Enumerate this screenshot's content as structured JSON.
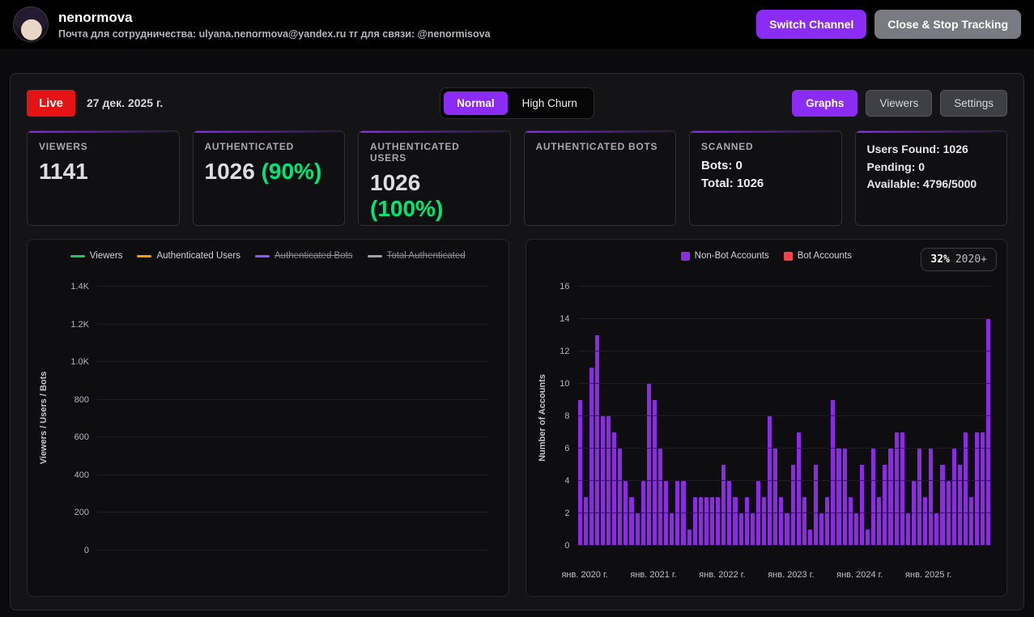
{
  "header": {
    "channel_name": "nenormova",
    "subtitle": "Почта для сотрудничества: ulyana.nenormova@yandex.ru тг для связи: @nenormisova",
    "buttons": {
      "switch_channel": "Switch Channel",
      "close_stop": "Close & Stop Tracking"
    }
  },
  "toolbar": {
    "live": "Live",
    "date": "27 дек. 2025 г.",
    "modes": {
      "normal": "Normal",
      "high_churn": "High Churn"
    },
    "views": {
      "graphs": "Graphs",
      "viewers": "Viewers",
      "settings": "Settings"
    }
  },
  "stats": {
    "viewers": {
      "title": "VIEWERS",
      "value": "1141"
    },
    "authenticated": {
      "title": "AUTHENTICATED",
      "value": "1026",
      "percent": "(90%)"
    },
    "authenticated_users": {
      "title": "AUTHENTICATED USERS",
      "value": "1026",
      "percent": "(100%)"
    },
    "authenticated_bots": {
      "title": "AUTHENTICATED BOTS"
    },
    "scanned": {
      "title": "SCANNED",
      "bots": "Bots: 0",
      "total": "Total: 1026"
    },
    "capacity": {
      "users_found": "Users Found: 1026",
      "pending": "Pending: 0",
      "available": "Available: 4796/5000"
    }
  },
  "colors": {
    "accent_purple": "#8b2cf5",
    "live_red": "#e51313",
    "green": "#00e676",
    "bar_purple": "#8b2be2",
    "bot_red": "#ef4444"
  },
  "chart_data": [
    {
      "type": "line",
      "ylabel": "Viewers / Users / Bots",
      "ylim": [
        0,
        1400
      ],
      "yticks": [
        "0",
        "200",
        "400",
        "600",
        "800",
        "1.0K",
        "1.2K",
        "1.4K"
      ],
      "legend": [
        {
          "label": "Viewers",
          "color": "#22c55e",
          "disabled": false
        },
        {
          "label": "Authenticated Users",
          "color": "#f59e0b",
          "disabled": false
        },
        {
          "label": "Authenticated Bots",
          "color": "#8b5cf6",
          "disabled": true
        },
        {
          "label": "Total Authenticated",
          "color": "#9ca3af",
          "disabled": true
        }
      ],
      "series": [],
      "note": "no data plotted yet"
    },
    {
      "type": "bar",
      "ylabel": "Number of Accounts",
      "ylim": [
        0,
        16
      ],
      "yticks": [
        "0",
        "2",
        "4",
        "6",
        "8",
        "10",
        "12",
        "14",
        "16"
      ],
      "badge": {
        "percent": "32%",
        "suffix": "2020+"
      },
      "legend": [
        {
          "label": "Non-Bot Accounts",
          "color": "#8b2be2"
        },
        {
          "label": "Bot Accounts",
          "color": "#ef4444"
        }
      ],
      "x_tick_labels": [
        "янв. 2020 г.",
        "янв. 2021 г.",
        "янв. 2022 г.",
        "янв. 2023 г.",
        "янв. 2024 г.",
        "янв. 2025 г."
      ],
      "x_tick_positions": [
        0,
        12,
        24,
        36,
        48,
        60
      ],
      "months_total": 72,
      "values": [
        9,
        3,
        11,
        13,
        8,
        8,
        7,
        6,
        4,
        3,
        2,
        4,
        10,
        9,
        6,
        4,
        2,
        4,
        4,
        1,
        3,
        3,
        3,
        3,
        3,
        5,
        4,
        3,
        2,
        3,
        2,
        4,
        3,
        8,
        6,
        3,
        2,
        5,
        7,
        3,
        1,
        5,
        2,
        3,
        9,
        6,
        6,
        3,
        2,
        5,
        1,
        6,
        3,
        5,
        6,
        7,
        7,
        2,
        4,
        6,
        3,
        6,
        2,
        5,
        4,
        6,
        5,
        7,
        3,
        7,
        7,
        14
      ],
      "bot_values_all_zero": true
    }
  ]
}
